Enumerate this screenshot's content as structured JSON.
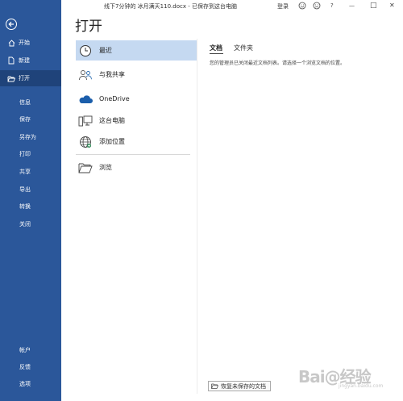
{
  "titlebar": {
    "doc_title": "线下7分钟的 冰月满天110.docx - 已保存到这台电脑",
    "login": "登录",
    "icons": [
      "smiley-icon",
      "frown-icon",
      "help-icon",
      "minimize-icon",
      "restore-icon",
      "close-icon"
    ],
    "help_glyph": "?",
    "minimize_glyph": "—",
    "restore_glyph": "□",
    "close_glyph": "✕"
  },
  "nav": {
    "items_top": [
      {
        "label": "开始",
        "icon": "home-icon"
      },
      {
        "label": "新建",
        "icon": "new-document-icon"
      },
      {
        "label": "打开",
        "icon": "folder-open-icon",
        "selected": true
      }
    ],
    "items_middle": [
      "信息",
      "保存",
      "另存为",
      "打印",
      "共享",
      "导出",
      "转换",
      "关闭"
    ],
    "items_bottom": [
      "帐户",
      "反馈",
      "选项"
    ],
    "bg_color": "#2b579a",
    "selected_color": "#1f437a"
  },
  "page": {
    "heading": "打开"
  },
  "locations": [
    {
      "label": "最近",
      "icon": "clock-icon",
      "selected": true
    },
    {
      "label": "与我共享",
      "icon": "shared-people-icon"
    },
    {
      "label": "OneDrive",
      "icon": "cloud-icon"
    },
    {
      "label": "这台电脑",
      "icon": "computer-icon"
    },
    {
      "label": "添加位置",
      "icon": "globe-icon"
    },
    {
      "label": "浏览",
      "icon": "folder-icon"
    }
  ],
  "right_pane": {
    "tabs": [
      {
        "label": "文档",
        "active": true
      },
      {
        "label": "文件夹",
        "active": false
      }
    ],
    "message": "您的管理员已关闭最近文档列表。请选择一个浏览文档的位置。",
    "recover_button": "恢复未保存的文档"
  },
  "watermark": {
    "text": "Bai@经验",
    "url": "jingyan.baidu.com"
  }
}
